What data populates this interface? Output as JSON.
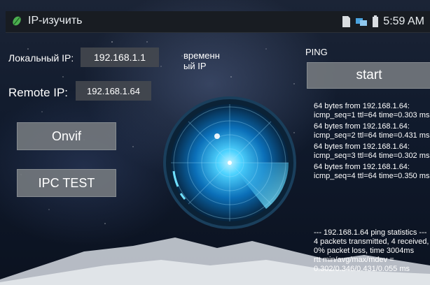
{
  "status_bar": {
    "app_title": "IP-изучить",
    "time": "5:59 AM"
  },
  "local_ip": {
    "label": "Локальный IP:",
    "value": "192.168.1.1"
  },
  "temp_ip_label": "временн\nый IP",
  "remote_ip": {
    "label": "Remote IP:",
    "value": "192.168.1.64"
  },
  "buttons": {
    "onvif": "Onvif",
    "ipc_test": "IPC TEST",
    "start": "start"
  },
  "ping": {
    "title": "PING",
    "replies": [
      "64 bytes from 192.168.1.64: icmp_seq=1 ttl=64 time=0.303 ms",
      "64 bytes from 192.168.1.64: icmp_seq=2 ttl=64 time=0.431 ms",
      "64 bytes from 192.168.1.64: icmp_seq=3 ttl=64 time=0.302 ms",
      "64 bytes from 192.168.1.64: icmp_seq=4 ttl=64 time=0.350 ms"
    ],
    "stats_header": "--- 192.168.1.64 ping statistics ---",
    "stats_summary": "4 packets transmitted, 4 received, 0% packet loss, time 3004ms",
    "rtt": "rtt min/avg/max/mdev = 0.302/0.346/0.431/0.055 ms"
  },
  "colors": {
    "radar_accent": "#2fc3ff",
    "button_bg": "#767b80",
    "field_bg": "#464a50"
  }
}
